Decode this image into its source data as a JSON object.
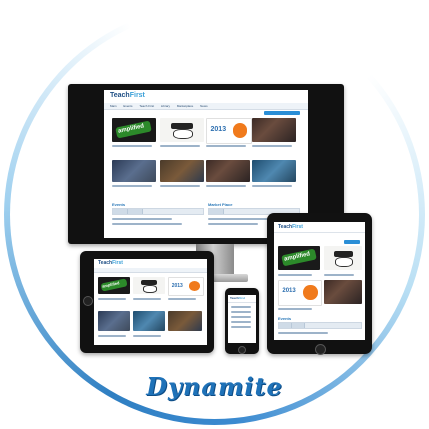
{
  "brand": {
    "wordmark": "Dynamite"
  },
  "site": {
    "logo_primary": "Teach",
    "logo_secondary": "First",
    "nav": [
      "Main",
      "Events",
      "Teach First",
      "Library",
      "Marketplace",
      "News"
    ],
    "amplified_label": "amplified",
    "year_label": "2013",
    "events_title": "Events",
    "market_title": "Market Place"
  },
  "colors": {
    "accent": "#2a8ed6",
    "brand": "#1f72b8",
    "ring": "#3b8ad0"
  }
}
